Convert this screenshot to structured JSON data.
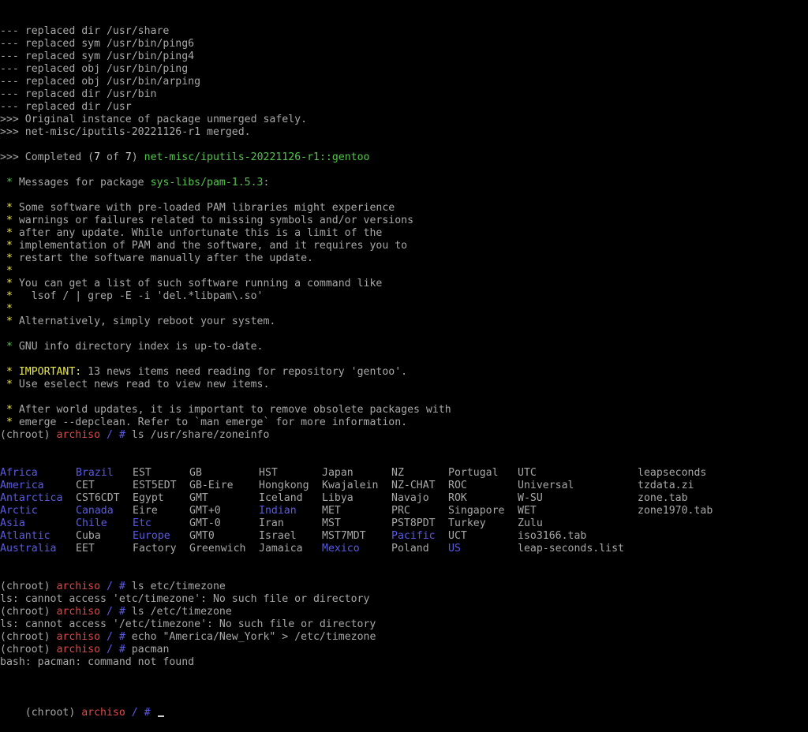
{
  "colors": {
    "text": "#a8a8a8",
    "green": "#54c44c",
    "bright_green": "#62e862",
    "yellow": "#e8e84c",
    "red": "#e04848",
    "blue": "#5a5ae8",
    "background": "#000000"
  },
  "lines_top": [
    [
      {
        "t": "--- replaced dir /usr/share",
        "c": "default"
      }
    ],
    [
      {
        "t": "--- replaced sym /usr/bin/ping6",
        "c": "default"
      }
    ],
    [
      {
        "t": "--- replaced sym /usr/bin/ping4",
        "c": "default"
      }
    ],
    [
      {
        "t": "--- replaced obj /usr/bin/ping",
        "c": "default"
      }
    ],
    [
      {
        "t": "--- replaced obj /usr/bin/arping",
        "c": "default"
      }
    ],
    [
      {
        "t": "--- replaced dir /usr/bin",
        "c": "default"
      }
    ],
    [
      {
        "t": "--- replaced dir /usr",
        "c": "default"
      }
    ],
    [
      {
        "t": ">>> Original instance of package unmerged safely.",
        "c": "default"
      }
    ],
    [
      {
        "t": ">>> net-misc/iputils-20221126-r1 merged.",
        "c": "default"
      }
    ],
    [
      {
        "t": "",
        "c": "default"
      }
    ],
    [
      {
        "t": ">>> Completed (",
        "c": "default"
      },
      {
        "t": "7",
        "c": "bold"
      },
      {
        "t": " of ",
        "c": "default"
      },
      {
        "t": "7",
        "c": "bold"
      },
      {
        "t": ") ",
        "c": "default"
      },
      {
        "t": "net-misc/iputils-20221126-r1::gentoo",
        "c": "green"
      }
    ],
    [
      {
        "t": "",
        "c": "default"
      }
    ],
    [
      {
        "t": " * ",
        "c": "green"
      },
      {
        "t": "Messages for package ",
        "c": "default"
      },
      {
        "t": "sys-libs/pam-1.5.3",
        "c": "green"
      },
      {
        "t": ":",
        "c": "default"
      }
    ],
    [
      {
        "t": "",
        "c": "default"
      }
    ],
    [
      {
        "t": " * ",
        "c": "yellow"
      },
      {
        "t": "Some software with pre-loaded PAM libraries might experience",
        "c": "default"
      }
    ],
    [
      {
        "t": " * ",
        "c": "yellow"
      },
      {
        "t": "warnings or failures related to missing symbols and/or versions",
        "c": "default"
      }
    ],
    [
      {
        "t": " * ",
        "c": "yellow"
      },
      {
        "t": "after any update. While unfortunate this is a limit of the",
        "c": "default"
      }
    ],
    [
      {
        "t": " * ",
        "c": "yellow"
      },
      {
        "t": "implementation of PAM and the software, and it requires you to",
        "c": "default"
      }
    ],
    [
      {
        "t": " * ",
        "c": "yellow"
      },
      {
        "t": "restart the software manually after the update.",
        "c": "default"
      }
    ],
    [
      {
        "t": " * ",
        "c": "yellow"
      }
    ],
    [
      {
        "t": " * ",
        "c": "yellow"
      },
      {
        "t": "You can get a list of such software running a command like",
        "c": "default"
      }
    ],
    [
      {
        "t": " * ",
        "c": "yellow"
      },
      {
        "t": "  lsof / | grep -E -i 'del.*libpam\\.so'",
        "c": "default"
      }
    ],
    [
      {
        "t": " * ",
        "c": "yellow"
      }
    ],
    [
      {
        "t": " * ",
        "c": "yellow"
      },
      {
        "t": "Alternatively, simply reboot your system.",
        "c": "default"
      }
    ],
    [
      {
        "t": "",
        "c": "default"
      }
    ],
    [
      {
        "t": " * ",
        "c": "green"
      },
      {
        "t": "GNU info directory index is up-to-date.",
        "c": "default"
      }
    ],
    [
      {
        "t": "",
        "c": "default"
      }
    ],
    [
      {
        "t": " * ",
        "c": "yellow"
      },
      {
        "t": "IMPORTANT:",
        "c": "yellow"
      },
      {
        "t": " 13 news items need reading for repository 'gentoo'.",
        "c": "default"
      }
    ],
    [
      {
        "t": " * ",
        "c": "yellow"
      },
      {
        "t": "Use ",
        "c": "default"
      },
      {
        "t": "eselect news read",
        "c": "bright_green"
      },
      {
        "t": " to view new items.",
        "c": "default"
      }
    ],
    [
      {
        "t": "",
        "c": "default"
      }
    ],
    [
      {
        "t": " * ",
        "c": "yellow"
      },
      {
        "t": "After world updates, it is important to remove obsolete packages with",
        "c": "default"
      }
    ],
    [
      {
        "t": " * ",
        "c": "yellow"
      },
      {
        "t": "emerge --depclean. Refer to `man emerge` for more information.",
        "c": "default"
      }
    ],
    [
      {
        "t": "(chroot) ",
        "c": "default"
      },
      {
        "t": "archiso",
        "c": "red"
      },
      {
        "t": " / # ",
        "c": "blue"
      },
      {
        "t": "ls /usr/share/zoneinfo",
        "c": "default"
      }
    ]
  ],
  "ls_listing": {
    "rows": [
      [
        {
          "t": "Africa",
          "c": "blue"
        },
        {
          "t": "Brazil",
          "c": "blue"
        },
        {
          "t": "EST",
          "c": "default"
        },
        {
          "t": "GB",
          "c": "default"
        },
        {
          "t": "HST",
          "c": "default"
        },
        {
          "t": "Japan",
          "c": "default"
        },
        {
          "t": "NZ",
          "c": "default"
        },
        {
          "t": "Portugal",
          "c": "default"
        },
        {
          "t": "UTC",
          "c": "default"
        },
        {
          "t": "leapseconds",
          "c": "default"
        }
      ],
      [
        {
          "t": "America",
          "c": "blue"
        },
        {
          "t": "CET",
          "c": "default"
        },
        {
          "t": "EST5EDT",
          "c": "default"
        },
        {
          "t": "GB-Eire",
          "c": "default"
        },
        {
          "t": "Hongkong",
          "c": "default"
        },
        {
          "t": "Kwajalein",
          "c": "default"
        },
        {
          "t": "NZ-CHAT",
          "c": "default"
        },
        {
          "t": "ROC",
          "c": "default"
        },
        {
          "t": "Universal",
          "c": "default"
        },
        {
          "t": "tzdata.zi",
          "c": "default"
        }
      ],
      [
        {
          "t": "Antarctica",
          "c": "blue"
        },
        {
          "t": "CST6CDT",
          "c": "default"
        },
        {
          "t": "Egypt",
          "c": "default"
        },
        {
          "t": "GMT",
          "c": "default"
        },
        {
          "t": "Iceland",
          "c": "default"
        },
        {
          "t": "Libya",
          "c": "default"
        },
        {
          "t": "Navajo",
          "c": "default"
        },
        {
          "t": "ROK",
          "c": "default"
        },
        {
          "t": "W-SU",
          "c": "default"
        },
        {
          "t": "zone.tab",
          "c": "default"
        }
      ],
      [
        {
          "t": "Arctic",
          "c": "blue"
        },
        {
          "t": "Canada",
          "c": "blue"
        },
        {
          "t": "Eire",
          "c": "default"
        },
        {
          "t": "GMT+0",
          "c": "default"
        },
        {
          "t": "Indian",
          "c": "blue"
        },
        {
          "t": "MET",
          "c": "default"
        },
        {
          "t": "PRC",
          "c": "default"
        },
        {
          "t": "Singapore",
          "c": "default"
        },
        {
          "t": "WET",
          "c": "default"
        },
        {
          "t": "zone1970.tab",
          "c": "default"
        }
      ],
      [
        {
          "t": "Asia",
          "c": "blue"
        },
        {
          "t": "Chile",
          "c": "blue"
        },
        {
          "t": "Etc",
          "c": "blue"
        },
        {
          "t": "GMT-0",
          "c": "default"
        },
        {
          "t": "Iran",
          "c": "default"
        },
        {
          "t": "MST",
          "c": "default"
        },
        {
          "t": "PST8PDT",
          "c": "default"
        },
        {
          "t": "Turkey",
          "c": "default"
        },
        {
          "t": "Zulu",
          "c": "default"
        },
        {
          "t": "",
          "c": "default"
        }
      ],
      [
        {
          "t": "Atlantic",
          "c": "blue"
        },
        {
          "t": "Cuba",
          "c": "default"
        },
        {
          "t": "Europe",
          "c": "blue"
        },
        {
          "t": "GMT0",
          "c": "default"
        },
        {
          "t": "Israel",
          "c": "default"
        },
        {
          "t": "MST7MDT",
          "c": "default"
        },
        {
          "t": "Pacific",
          "c": "blue"
        },
        {
          "t": "UCT",
          "c": "default"
        },
        {
          "t": "iso3166.tab",
          "c": "default"
        },
        {
          "t": "",
          "c": "default"
        }
      ],
      [
        {
          "t": "Australia",
          "c": "blue"
        },
        {
          "t": "EET",
          "c": "default"
        },
        {
          "t": "Factory",
          "c": "default"
        },
        {
          "t": "Greenwich",
          "c": "default"
        },
        {
          "t": "Jamaica",
          "c": "default"
        },
        {
          "t": "Mexico",
          "c": "blue"
        },
        {
          "t": "Poland",
          "c": "default"
        },
        {
          "t": "US",
          "c": "blue"
        },
        {
          "t": "leap-seconds.list",
          "c": "default"
        },
        {
          "t": "",
          "c": "default"
        }
      ]
    ]
  },
  "lines_bottom": [
    [
      {
        "t": "(chroot) ",
        "c": "default"
      },
      {
        "t": "archiso",
        "c": "red"
      },
      {
        "t": " / # ",
        "c": "blue"
      },
      {
        "t": "ls etc/timezone",
        "c": "default"
      }
    ],
    [
      {
        "t": "ls: cannot access 'etc/timezone': No such file or directory",
        "c": "default"
      }
    ],
    [
      {
        "t": "(chroot) ",
        "c": "default"
      },
      {
        "t": "archiso",
        "c": "red"
      },
      {
        "t": " / # ",
        "c": "blue"
      },
      {
        "t": "ls /etc/timezone",
        "c": "default"
      }
    ],
    [
      {
        "t": "ls: cannot access '/etc/timezone': No such file or directory",
        "c": "default"
      }
    ],
    [
      {
        "t": "(chroot) ",
        "c": "default"
      },
      {
        "t": "archiso",
        "c": "red"
      },
      {
        "t": " / # ",
        "c": "blue"
      },
      {
        "t": "echo \"America/New_York\" > /etc/timezone",
        "c": "default"
      }
    ],
    [
      {
        "t": "(chroot) ",
        "c": "default"
      },
      {
        "t": "archiso",
        "c": "red"
      },
      {
        "t": " / # ",
        "c": "blue"
      },
      {
        "t": "pacman",
        "c": "default"
      }
    ],
    [
      {
        "t": "bash: pacman: command not found",
        "c": "default"
      }
    ]
  ],
  "prompt": {
    "chroot": "(chroot) ",
    "host": "archiso",
    "path_hash": " / # "
  }
}
